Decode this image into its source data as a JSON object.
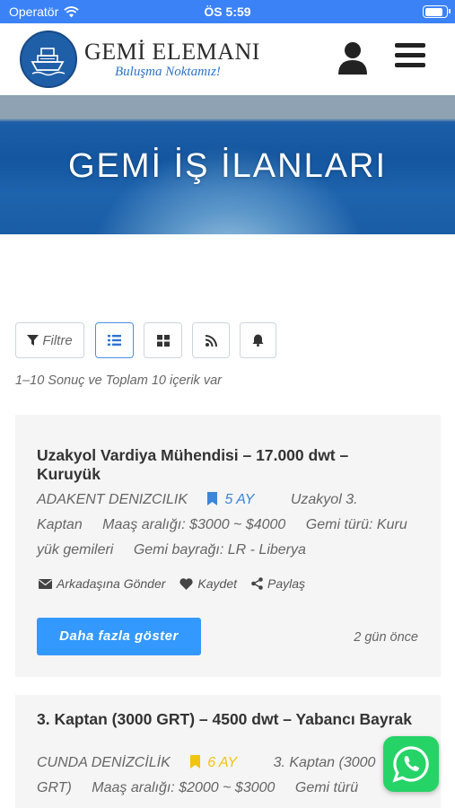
{
  "status_bar": {
    "carrier": "Operatör",
    "time": "ÖS 5:59",
    "battery_level": 0.85
  },
  "header": {
    "logo_title": "GEMİ ELEMANI",
    "logo_subtitle": "Buluşma Noktamız!"
  },
  "hero": {
    "title": "GEMİ İŞ İLANLARI"
  },
  "toolbar": {
    "filter_label": "Filtre",
    "active_view": "list"
  },
  "results": {
    "summary": "1–10 Sonuç ve Toplam 10 içerik var"
  },
  "listings": [
    {
      "title": "Uzakyol Vardiya Mühendisi – 17.000 dwt – Kuruyük",
      "company": "ADAKENT DENIZCILIK",
      "duration": "5 AY",
      "rank": "Uzakyol 3. Kaptan",
      "salary": "Maaş aralığı: $3000 ~ $4000",
      "ship_type": "Gemi türü: Kuru yük gemileri",
      "flag": "Gemi bayrağı: LR - Liberya",
      "bookmark_color": "#3b86d8",
      "send_label": "Arkadaşına Gönder",
      "save_label": "Kaydet",
      "share_label": "Paylaş",
      "more_label": "Daha fazla göster",
      "posted": "2 gün önce"
    },
    {
      "title": "3. Kaptan (3000 GRT) – 4500 dwt – Yabancı Bayrak",
      "company": "CUNDA DENİZCİLİK",
      "duration": "6 AY",
      "rank": "3. Kaptan (3000 GRT)",
      "salary": "Maaş aralığı: $2000 ~ $3000",
      "ship_type": "Gemi türü",
      "bookmark_color": "#f1c40f"
    }
  ],
  "colors": {
    "primary": "#3399ff",
    "status_bar": "#3b82f6",
    "whatsapp": "#25d366"
  },
  "icons": [
    "user-icon",
    "menu-icon",
    "filter-icon",
    "list-icon",
    "grid-icon",
    "rss-icon",
    "bell-icon",
    "envelope-icon",
    "heart-icon",
    "share-icon",
    "bookmark-icon",
    "whatsapp-icon",
    "wifi-icon",
    "battery-icon"
  ]
}
